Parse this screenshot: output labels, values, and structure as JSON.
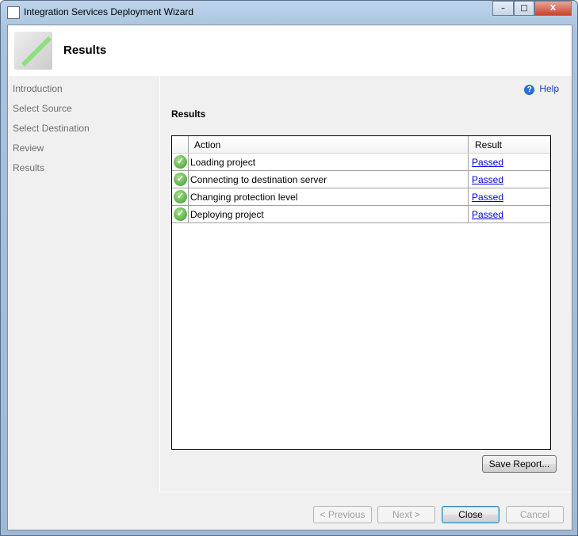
{
  "window": {
    "title": "Integration Services Deployment Wizard",
    "minimize": "–",
    "maximize": "□",
    "close": "X"
  },
  "header": {
    "title": "Results"
  },
  "nav": {
    "items": [
      {
        "label": "Introduction"
      },
      {
        "label": "Select Source"
      },
      {
        "label": "Select Destination"
      },
      {
        "label": "Review"
      },
      {
        "label": "Results"
      }
    ]
  },
  "main": {
    "help": "Help",
    "section_title": "Results",
    "table": {
      "columns": [
        "Action",
        "Result"
      ],
      "rows": [
        {
          "action": "Loading project",
          "result": "Passed",
          "status": "success"
        },
        {
          "action": "Connecting to destination server",
          "result": "Passed",
          "status": "success"
        },
        {
          "action": "Changing protection level",
          "result": "Passed",
          "status": "success"
        },
        {
          "action": "Deploying project",
          "result": "Passed",
          "status": "success"
        }
      ]
    },
    "save_report": "Save Report..."
  },
  "footer": {
    "previous": "< Previous",
    "next": "Next >",
    "close": "Close",
    "cancel": "Cancel"
  }
}
